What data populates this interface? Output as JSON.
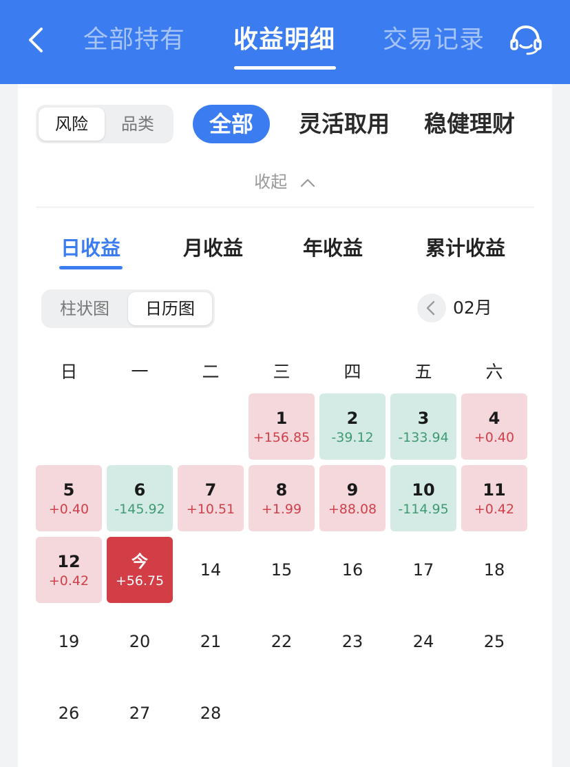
{
  "header": {
    "tabs": [
      {
        "label": "全部持有",
        "active": false
      },
      {
        "label": "收益明细",
        "active": true
      },
      {
        "label": "交易记录",
        "active": false
      }
    ],
    "back_icon": "chevron-left-icon",
    "service_icon": "headset-icon"
  },
  "filter": {
    "segment": [
      {
        "label": "风险",
        "selected": true
      },
      {
        "label": "品类",
        "selected": false
      }
    ],
    "categories": [
      {
        "label": "全部",
        "selected": true
      },
      {
        "label": "灵活取用",
        "selected": false
      },
      {
        "label": "稳健理财",
        "selected": false
      }
    ],
    "collapse_label": "收起"
  },
  "period_tabs": [
    {
      "label": "日收益",
      "active": true
    },
    {
      "label": "月收益",
      "active": false
    },
    {
      "label": "年收益",
      "active": false
    },
    {
      "label": "累计收益",
      "active": false
    }
  ],
  "view_toggle": [
    {
      "label": "柱状图",
      "selected": false
    },
    {
      "label": "日历图",
      "selected": true
    }
  ],
  "month": "02月",
  "weekdays": [
    "日",
    "一",
    "二",
    "三",
    "四",
    "五",
    "六"
  ],
  "calendar": {
    "first_weekday_index": 3,
    "days": [
      {
        "day": "1",
        "value": "+156.85",
        "type": "pos"
      },
      {
        "day": "2",
        "value": "-39.12",
        "type": "neg"
      },
      {
        "day": "3",
        "value": "-133.94",
        "type": "neg"
      },
      {
        "day": "4",
        "value": "+0.40",
        "type": "pos"
      },
      {
        "day": "5",
        "value": "+0.40",
        "type": "pos"
      },
      {
        "day": "6",
        "value": "-145.92",
        "type": "neg"
      },
      {
        "day": "7",
        "value": "+10.51",
        "type": "pos"
      },
      {
        "day": "8",
        "value": "+1.99",
        "type": "pos"
      },
      {
        "day": "9",
        "value": "+88.08",
        "type": "pos"
      },
      {
        "day": "10",
        "value": "-114.95",
        "type": "neg"
      },
      {
        "day": "11",
        "value": "+0.42",
        "type": "pos"
      },
      {
        "day": "12",
        "value": "+0.42",
        "type": "pos"
      },
      {
        "day": "今",
        "value": "+56.75",
        "type": "today"
      },
      {
        "day": "14",
        "value": "",
        "type": "plain"
      },
      {
        "day": "15",
        "value": "",
        "type": "plain"
      },
      {
        "day": "16",
        "value": "",
        "type": "plain"
      },
      {
        "day": "17",
        "value": "",
        "type": "plain"
      },
      {
        "day": "18",
        "value": "",
        "type": "plain"
      },
      {
        "day": "19",
        "value": "",
        "type": "plain"
      },
      {
        "day": "20",
        "value": "",
        "type": "plain"
      },
      {
        "day": "21",
        "value": "",
        "type": "plain"
      },
      {
        "day": "22",
        "value": "",
        "type": "plain"
      },
      {
        "day": "23",
        "value": "",
        "type": "plain"
      },
      {
        "day": "24",
        "value": "",
        "type": "plain"
      },
      {
        "day": "25",
        "value": "",
        "type": "plain"
      },
      {
        "day": "26",
        "value": "",
        "type": "plain"
      },
      {
        "day": "27",
        "value": "",
        "type": "plain"
      },
      {
        "day": "28",
        "value": "",
        "type": "plain"
      }
    ]
  },
  "colors": {
    "primary": "#3b7cf0",
    "positive_bg": "#f5d8dc",
    "positive_text": "#d0404a",
    "negative_bg": "#d4ebe5",
    "negative_text": "#3e9a73",
    "today_bg": "#d23d46"
  }
}
